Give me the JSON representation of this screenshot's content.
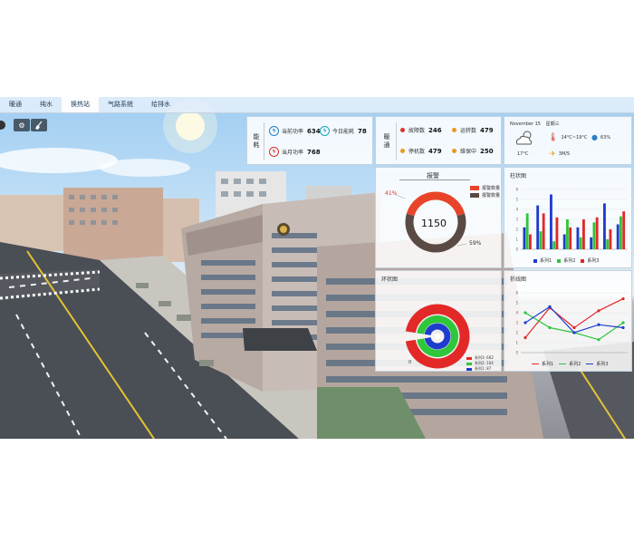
{
  "nav": {
    "tabs": [
      {
        "label": "暖通"
      },
      {
        "label": "纯水"
      },
      {
        "label": "换热站"
      },
      {
        "label": "气路系统"
      },
      {
        "label": "给排水"
      }
    ],
    "active_index": 2
  },
  "tools": {
    "settings_icon": "gear-icon",
    "broom_icon": "broom-icon"
  },
  "energy": {
    "label": "能耗",
    "items": [
      {
        "label": "当前功率",
        "value": "634",
        "icon": "lightning-icon",
        "color": "#2a7fc4"
      },
      {
        "label": "今日能耗",
        "value": "78",
        "icon": "lightning-icon",
        "color": "#1ea3b8"
      },
      {
        "label": "当月功率",
        "value": "768",
        "icon": "lightning-icon",
        "color": "#d9342b"
      }
    ]
  },
  "hvac": {
    "label": "暖通",
    "items": [
      {
        "label": "故障数",
        "value": "246",
        "color": "#d9342b"
      },
      {
        "label": "运转数",
        "value": "479",
        "color": "#e89a1f"
      },
      {
        "label": "停机数",
        "value": "479",
        "color": "#e89a1f"
      },
      {
        "label": "维保中",
        "value": "250",
        "color": "#e89a1f"
      }
    ]
  },
  "weather": {
    "date": "November 15",
    "weekday": "星期三",
    "temp": "17°C",
    "range": "14°C~19°C",
    "humidity": "63%",
    "wind": "3M/S",
    "colors": {
      "thermo": "#d9342b",
      "drop": "#2a7fc4",
      "wind": "#e89a1f"
    }
  },
  "alarm": {
    "title": "报警",
    "total": "1150",
    "pct_red": "41%",
    "pct_gray": "59%",
    "legend": [
      {
        "label": "报警数量",
        "color": "#e8442a"
      },
      {
        "label": "报警数量",
        "color": "#5a4a44"
      }
    ],
    "chart_data": {
      "type": "pie",
      "slices": [
        {
          "value": 41,
          "color": "#e8442a"
        },
        {
          "value": 59,
          "color": "#5a4a44"
        }
      ]
    }
  },
  "bar_panel": {
    "title": "柱状图",
    "chart_data": {
      "type": "bar",
      "ylim": [
        0,
        6
      ],
      "yticks": [
        "0",
        "1",
        "2",
        "3",
        "4",
        "5",
        "6"
      ],
      "categories": [
        "",
        "",
        "",
        "",
        "",
        "",
        "",
        ""
      ],
      "series": [
        {
          "name": "系列1",
          "color": "#1f3ccc",
          "values": [
            2.2,
            4.4,
            5.5,
            1.5,
            2.2,
            1.2,
            4.6,
            2.5
          ]
        },
        {
          "name": "系列2",
          "color": "#2fc63a",
          "values": [
            3.6,
            1.8,
            0.8,
            3.0,
            1.2,
            2.7,
            1.0,
            3.3
          ]
        },
        {
          "name": "系列3",
          "color": "#e32828",
          "values": [
            1.5,
            3.6,
            3.2,
            2.2,
            3.0,
            3.2,
            2.0,
            3.8
          ]
        }
      ]
    }
  },
  "gauge_panel": {
    "title": "环状图",
    "left_label": "0",
    "legend": [
      {
        "label": "系列3: 602",
        "color": "#e32828"
      },
      {
        "label": "系列2: 104",
        "color": "#2fc63a"
      },
      {
        "label": "系列1: 87",
        "color": "#1f3ccc"
      }
    ],
    "chart_data": {
      "type": "pie",
      "series": [
        {
          "name": "系列3",
          "value": 602,
          "color": "#e32828"
        },
        {
          "name": "系列2",
          "value": 104,
          "color": "#2fc63a"
        },
        {
          "name": "系列1",
          "value": 87,
          "color": "#1f3ccc"
        }
      ]
    }
  },
  "line_panel": {
    "title": "折线图",
    "chart_data": {
      "type": "line",
      "ylim": [
        0,
        6
      ],
      "yticks": [
        "0",
        "1",
        "2",
        "3",
        "4",
        "5",
        "6"
      ],
      "x": [
        "",
        "",
        "",
        "",
        ""
      ],
      "series": [
        {
          "name": "系列1",
          "color": "#e32828",
          "values": [
            1.5,
            4.5,
            2.5,
            4.2,
            5.4
          ]
        },
        {
          "name": "系列2",
          "color": "#2fc63a",
          "values": [
            4.0,
            2.5,
            2.0,
            1.3,
            3.0
          ]
        },
        {
          "name": "系列3",
          "color": "#1f3ccc",
          "values": [
            3.0,
            4.6,
            2.0,
            2.8,
            2.5
          ]
        }
      ]
    }
  }
}
